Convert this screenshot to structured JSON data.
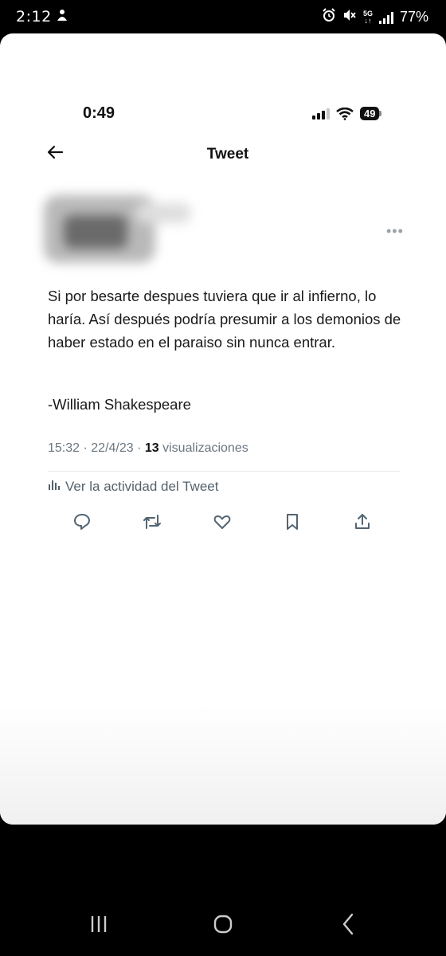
{
  "android_status": {
    "time": "2:12",
    "network": "5G",
    "battery": "77%"
  },
  "screenshot": {
    "status_bar": {
      "time": "0:49",
      "battery": "49"
    },
    "header": {
      "title": "Tweet"
    },
    "tweet": {
      "text": "Si por besarte despues tuviera que ir al infierno, lo haría. Así después podría presumir a los demonios de haber estado en el paraiso sin nunca entrar.",
      "signature": "-William Shakespeare",
      "time": "15:32",
      "separator1": " · ",
      "date": "22/4/23",
      "separator2": " · ",
      "views_count": "13",
      "views_label": " visualizaciones"
    },
    "activity_link": "Ver la actividad del Tweet",
    "actions": [
      "reply-icon",
      "retweet-icon",
      "like-icon",
      "bookmark-icon",
      "share-icon"
    ]
  },
  "nav": {
    "buttons": [
      "recents-icon",
      "home-icon",
      "back-icon"
    ]
  },
  "colors": {
    "text": "#1a1a1a",
    "secondary": "#6b7680",
    "divider": "#e7e9ec",
    "action_icon": "#536471"
  }
}
